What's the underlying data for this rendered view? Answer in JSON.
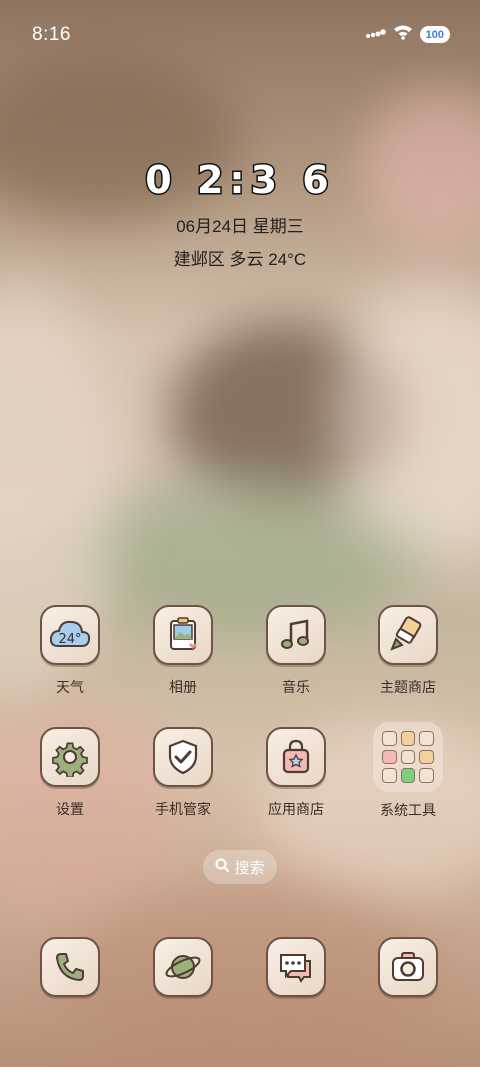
{
  "status_bar": {
    "time": "8:16",
    "battery": "100"
  },
  "clock_widget": {
    "time": "0 2:3 6",
    "date": "06月24日 星期三",
    "weather": "建邺区 多云 24°C"
  },
  "apps": {
    "weather": {
      "label": "天气",
      "badge": "24°"
    },
    "gallery": {
      "label": "相册"
    },
    "music": {
      "label": "音乐"
    },
    "theme_store": {
      "label": "主题商店"
    },
    "settings": {
      "label": "设置"
    },
    "phone_manager": {
      "label": "手机管家"
    },
    "app_store": {
      "label": "应用商店"
    },
    "system_tools": {
      "label": "系统工具"
    }
  },
  "search": {
    "label": "搜索"
  },
  "dock": [
    "phone",
    "browser",
    "messages",
    "camera"
  ]
}
